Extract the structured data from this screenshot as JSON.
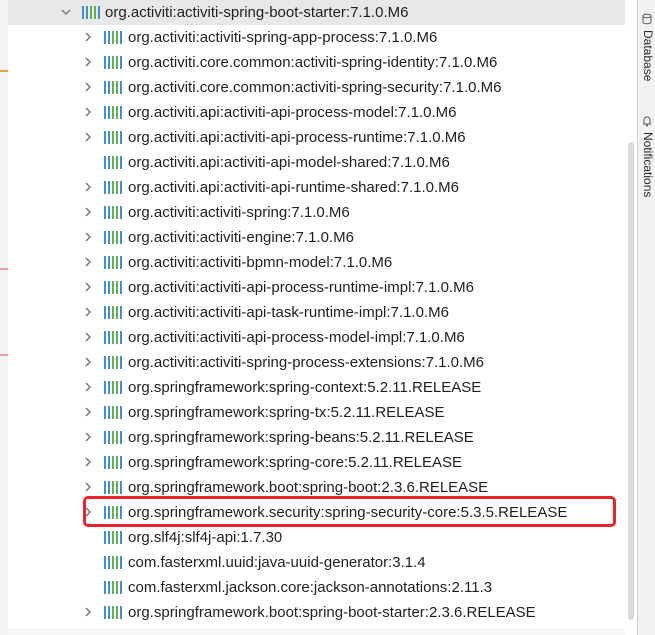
{
  "tree": {
    "parent": {
      "label": "org.activiti:activiti-spring-boot-starter:7.1.0.M6",
      "expanded": true
    },
    "children": [
      {
        "label": "org.activiti:activiti-spring-app-process:7.1.0.M6",
        "expandable": true
      },
      {
        "label": "org.activiti.core.common:activiti-spring-identity:7.1.0.M6",
        "expandable": true
      },
      {
        "label": "org.activiti.core.common:activiti-spring-security:7.1.0.M6",
        "expandable": true
      },
      {
        "label": "org.activiti.api:activiti-api-process-model:7.1.0.M6",
        "expandable": true
      },
      {
        "label": "org.activiti.api:activiti-api-process-runtime:7.1.0.M6",
        "expandable": true
      },
      {
        "label": "org.activiti.api:activiti-api-model-shared:7.1.0.M6",
        "expandable": false
      },
      {
        "label": "org.activiti.api:activiti-api-runtime-shared:7.1.0.M6",
        "expandable": true
      },
      {
        "label": "org.activiti:activiti-spring:7.1.0.M6",
        "expandable": true
      },
      {
        "label": "org.activiti:activiti-engine:7.1.0.M6",
        "expandable": true
      },
      {
        "label": "org.activiti:activiti-bpmn-model:7.1.0.M6",
        "expandable": true
      },
      {
        "label": "org.activiti:activiti-api-process-runtime-impl:7.1.0.M6",
        "expandable": true
      },
      {
        "label": "org.activiti:activiti-api-task-runtime-impl:7.1.0.M6",
        "expandable": true
      },
      {
        "label": "org.activiti:activiti-api-process-model-impl:7.1.0.M6",
        "expandable": true
      },
      {
        "label": "org.activiti:activiti-spring-process-extensions:7.1.0.M6",
        "expandable": true
      },
      {
        "label": "org.springframework:spring-context:5.2.11.RELEASE",
        "expandable": true
      },
      {
        "label": "org.springframework:spring-tx:5.2.11.RELEASE",
        "expandable": true
      },
      {
        "label": "org.springframework:spring-beans:5.2.11.RELEASE",
        "expandable": true
      },
      {
        "label": "org.springframework:spring-core:5.2.11.RELEASE",
        "expandable": true
      },
      {
        "label": "org.springframework.boot:spring-boot:2.3.6.RELEASE",
        "expandable": true
      },
      {
        "label": "org.springframework.security:spring-security-core:5.3.5.RELEASE",
        "expandable": true,
        "highlighted": true
      },
      {
        "label": "org.slf4j:slf4j-api:1.7.30",
        "expandable": false
      },
      {
        "label": "com.fasterxml.uuid:java-uuid-generator:3.1.4",
        "expandable": false
      },
      {
        "label": "com.fasterxml.jackson.core:jackson-annotations:2.11.3",
        "expandable": false
      },
      {
        "label": "org.springframework.boot:spring-boot-starter:2.3.6.RELEASE",
        "expandable": true
      }
    ]
  },
  "right_panel": {
    "tabs": [
      {
        "label": "Database",
        "icon": "database-icon"
      },
      {
        "label": "Notifications",
        "icon": "bell-icon"
      }
    ]
  },
  "colors": {
    "highlight": "#e8262a",
    "icon_blue": "#3f8fd2",
    "icon_green": "#61b04a",
    "chevron": "#7a7a7a"
  }
}
